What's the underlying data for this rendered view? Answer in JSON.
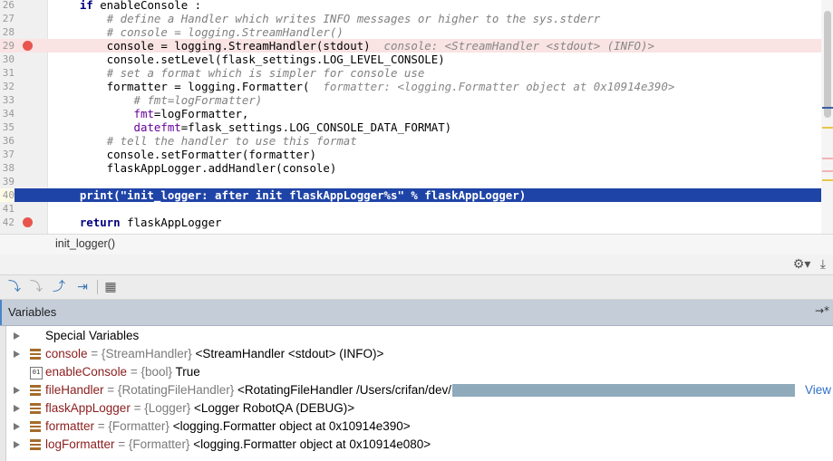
{
  "editor": {
    "lines": [
      {
        "no": "26",
        "html_code": [
          {
            "t": "    "
          },
          {
            "t": "if",
            "c": "kw"
          },
          {
            "t": " enableConsole :"
          }
        ]
      },
      {
        "no": "27",
        "html_code": [
          {
            "t": "        "
          },
          {
            "t": "# define a Handler which writes INFO messages or higher to the sys.stderr",
            "c": "cm"
          }
        ]
      },
      {
        "no": "28",
        "html_code": [
          {
            "t": "        "
          },
          {
            "t": "# console = logging.StreamHandler()",
            "c": "cm"
          }
        ]
      },
      {
        "no": "29",
        "bp": true,
        "row": "bp",
        "html_code": [
          {
            "t": "        console = logging.StreamHandler(stdout)  "
          },
          {
            "t": "console: <StreamHandler <stdout> (INFO)>",
            "c": "hint"
          }
        ]
      },
      {
        "no": "30",
        "html_code": [
          {
            "t": "        console.setLevel(flask_settings.LOG_LEVEL_CONSOLE)"
          }
        ]
      },
      {
        "no": "31",
        "html_code": [
          {
            "t": "        "
          },
          {
            "t": "# set a format which is simpler for console use",
            "c": "cm"
          }
        ]
      },
      {
        "no": "32",
        "html_code": [
          {
            "t": "        formatter = logging.Formatter(  "
          },
          {
            "t": "formatter: <logging.Formatter object at 0x10914e390>",
            "c": "hint"
          }
        ]
      },
      {
        "no": "33",
        "html_code": [
          {
            "t": "            "
          },
          {
            "t": "# fmt=logFormatter)",
            "c": "cm"
          }
        ]
      },
      {
        "no": "34",
        "html_code": [
          {
            "t": "            "
          },
          {
            "t": "fmt",
            "c": "param"
          },
          {
            "t": "=logFormatter,"
          }
        ]
      },
      {
        "no": "35",
        "html_code": [
          {
            "t": "            "
          },
          {
            "t": "datefmt",
            "c": "param"
          },
          {
            "t": "=flask_settings.LOG_CONSOLE_DATA_FORMAT)"
          }
        ]
      },
      {
        "no": "36",
        "html_code": [
          {
            "t": "        "
          },
          {
            "t": "# tell the handler to use this format",
            "c": "cm"
          }
        ]
      },
      {
        "no": "37",
        "html_code": [
          {
            "t": "        console.setFormatter(formatter)"
          }
        ]
      },
      {
        "no": "38",
        "html_code": [
          {
            "t": "        flaskAppLogger.addHandler(console)"
          }
        ]
      },
      {
        "no": "39",
        "html_code": [
          {
            "t": ""
          }
        ]
      },
      {
        "no": "40",
        "row": "exec",
        "html_code": [
          {
            "t": "    print(\"init_logger: after init flaskAppLogger%s\" % flaskAppLogger)"
          }
        ]
      },
      {
        "no": "41",
        "html_code": [
          {
            "t": ""
          }
        ]
      },
      {
        "no": "42",
        "bp": true,
        "html_code": [
          {
            "t": "    "
          },
          {
            "t": "return",
            "c": "kw"
          },
          {
            "t": " flaskAppLogger"
          }
        ]
      }
    ]
  },
  "breadcrumb": {
    "text": "init_logger()"
  },
  "debug_toolbar": {
    "icons": [
      "step-into-my-code-icon",
      "step-over-disabled-icon",
      "step-out-icon",
      "run-to-cursor-icon",
      "evaluate-expression-icon"
    ],
    "right_icons": [
      "gear-icon",
      "download-icon"
    ]
  },
  "variables": {
    "title": "Variables",
    "pin_label": "→*",
    "rows": [
      {
        "arrow": true,
        "icon": "special",
        "name": "Special Variables",
        "plain": true,
        "type": "",
        "value": ""
      },
      {
        "arrow": true,
        "icon": "obj",
        "name": "console",
        "type": " = {StreamHandler} ",
        "value": "<StreamHandler <stdout> (INFO)>"
      },
      {
        "arrow": false,
        "icon": "bool",
        "name": "enableConsole",
        "type": " = {bool} ",
        "value": "True"
      },
      {
        "arrow": true,
        "icon": "obj",
        "name": "fileHandler",
        "type": " = {RotatingFileHandler} ",
        "value": "<RotatingFileHandler /Users/crifan/dev/",
        "redacted": true,
        "link": "View"
      },
      {
        "arrow": true,
        "icon": "obj",
        "name": "flaskAppLogger",
        "type": " = {Logger} ",
        "value": "<Logger RobotQA (DEBUG)>"
      },
      {
        "arrow": true,
        "icon": "obj",
        "name": "formatter",
        "type": " = {Formatter} ",
        "value": "<logging.Formatter object at 0x10914e390>"
      },
      {
        "arrow": true,
        "icon": "obj",
        "name": "logFormatter",
        "type": " = {Formatter} ",
        "value": "<logging.Formatter object at 0x10914e080>"
      }
    ]
  }
}
